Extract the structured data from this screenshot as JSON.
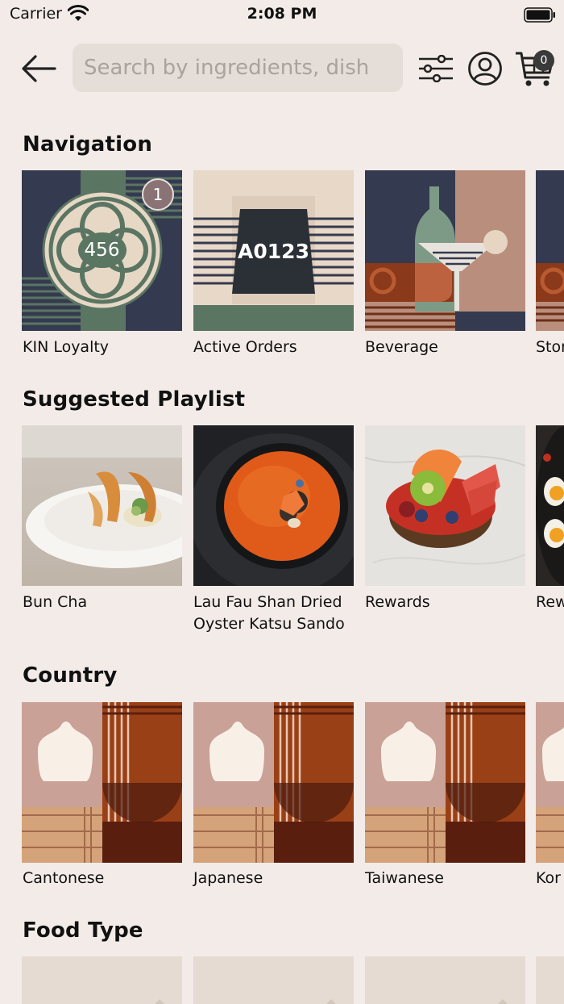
{
  "status_bar": {
    "carrier": "Carrier",
    "time": "2:08 PM"
  },
  "header": {
    "search_placeholder": "Search by ingredients, dish",
    "cart_count": "0"
  },
  "sections": {
    "navigation": {
      "title": "Navigation",
      "items": [
        {
          "label": "KIN Loyalty",
          "code": "456",
          "badge": "1"
        },
        {
          "label": "Active Orders",
          "code": "A0123"
        },
        {
          "label": "Beverage"
        },
        {
          "label": "Stor"
        }
      ]
    },
    "playlist": {
      "title": "Suggested Playlist",
      "items": [
        {
          "label": "Bun Cha"
        },
        {
          "label": "Lau Fau Shan Dried Oyster Katsu Sando"
        },
        {
          "label": "Rewards"
        },
        {
          "label": "Rew"
        }
      ]
    },
    "country": {
      "title": "Country",
      "items": [
        {
          "label": "Cantonese"
        },
        {
          "label": "Japanese"
        },
        {
          "label": "Taiwanese"
        },
        {
          "label": "Kor"
        }
      ]
    },
    "food_type": {
      "title": "Food Type"
    }
  },
  "colors": {
    "background": "#f3ebe7",
    "navy": "#343a4f",
    "sage": "#5b7563",
    "cream": "#e8d8c7",
    "rust": "#9a4016"
  },
  "icons": [
    "back-arrow-icon",
    "filter-icon",
    "account-icon",
    "cart-icon",
    "wifi-icon",
    "battery-icon"
  ]
}
